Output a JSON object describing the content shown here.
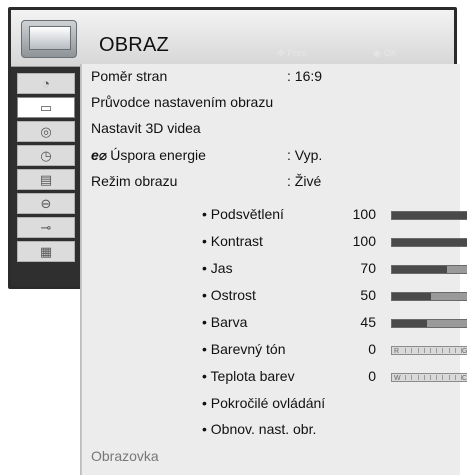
{
  "header": {
    "title": "OBRAZ",
    "hint_move_label": "Přes.",
    "hint_ok_label": "OK",
    "move_icon": "dpad-icon",
    "ok_icon": "ok-button-icon"
  },
  "sidebar": {
    "items": [
      {
        "icon": "satellite-dish-icon",
        "active": false
      },
      {
        "icon": "tv-picture-icon",
        "active": true
      },
      {
        "icon": "audio-dial-icon",
        "active": false
      },
      {
        "icon": "clock-icon",
        "active": false
      },
      {
        "icon": "briefcase-icon",
        "active": false
      },
      {
        "icon": "lock-icon",
        "active": false
      },
      {
        "icon": "input-cable-icon",
        "active": false
      },
      {
        "icon": "clapperboard-icon",
        "active": false
      }
    ]
  },
  "menu": {
    "aspect_ratio_label": "Poměr stran",
    "aspect_ratio_value": ": 16:9",
    "picture_wizard_label": "Průvodce nastavením obrazu",
    "setup_3d_label": "Nastavit 3D videa",
    "energy_saving_label": "Úspora energie",
    "energy_saving_value": ": Vyp.",
    "picture_mode_label": "Režim obrazu",
    "picture_mode_value": ": Živé"
  },
  "settings": [
    {
      "label": "• Podsvětlení",
      "value": "100",
      "level": 1.0,
      "kind": "bar"
    },
    {
      "label": "• Kontrast",
      "value": "100",
      "level": 1.0,
      "kind": "bar"
    },
    {
      "label": "• Jas",
      "value": "70",
      "level": 0.7,
      "kind": "bar"
    },
    {
      "label": "• Ostrost",
      "value": "50",
      "level": 0.5,
      "kind": "bar"
    },
    {
      "label": "• Barva",
      "value": "45",
      "level": 0.45,
      "kind": "bar"
    },
    {
      "label": "• Barevný tón",
      "value": "0",
      "kind": "tick",
      "left_end": "R",
      "right_end": "G"
    },
    {
      "label": "• Teplota barev",
      "value": "0",
      "kind": "tick",
      "left_end": "W",
      "right_end": "C"
    }
  ],
  "advanced": {
    "expert_label": "• Pokročilé ovládání",
    "reset_label": "• Obnov. nast. obr."
  },
  "footer": {
    "label": "Obrazovka"
  },
  "colors": {
    "panel": "#ececec",
    "frame": "#2b2b2b",
    "bar_fill": "#4a4a4a"
  }
}
